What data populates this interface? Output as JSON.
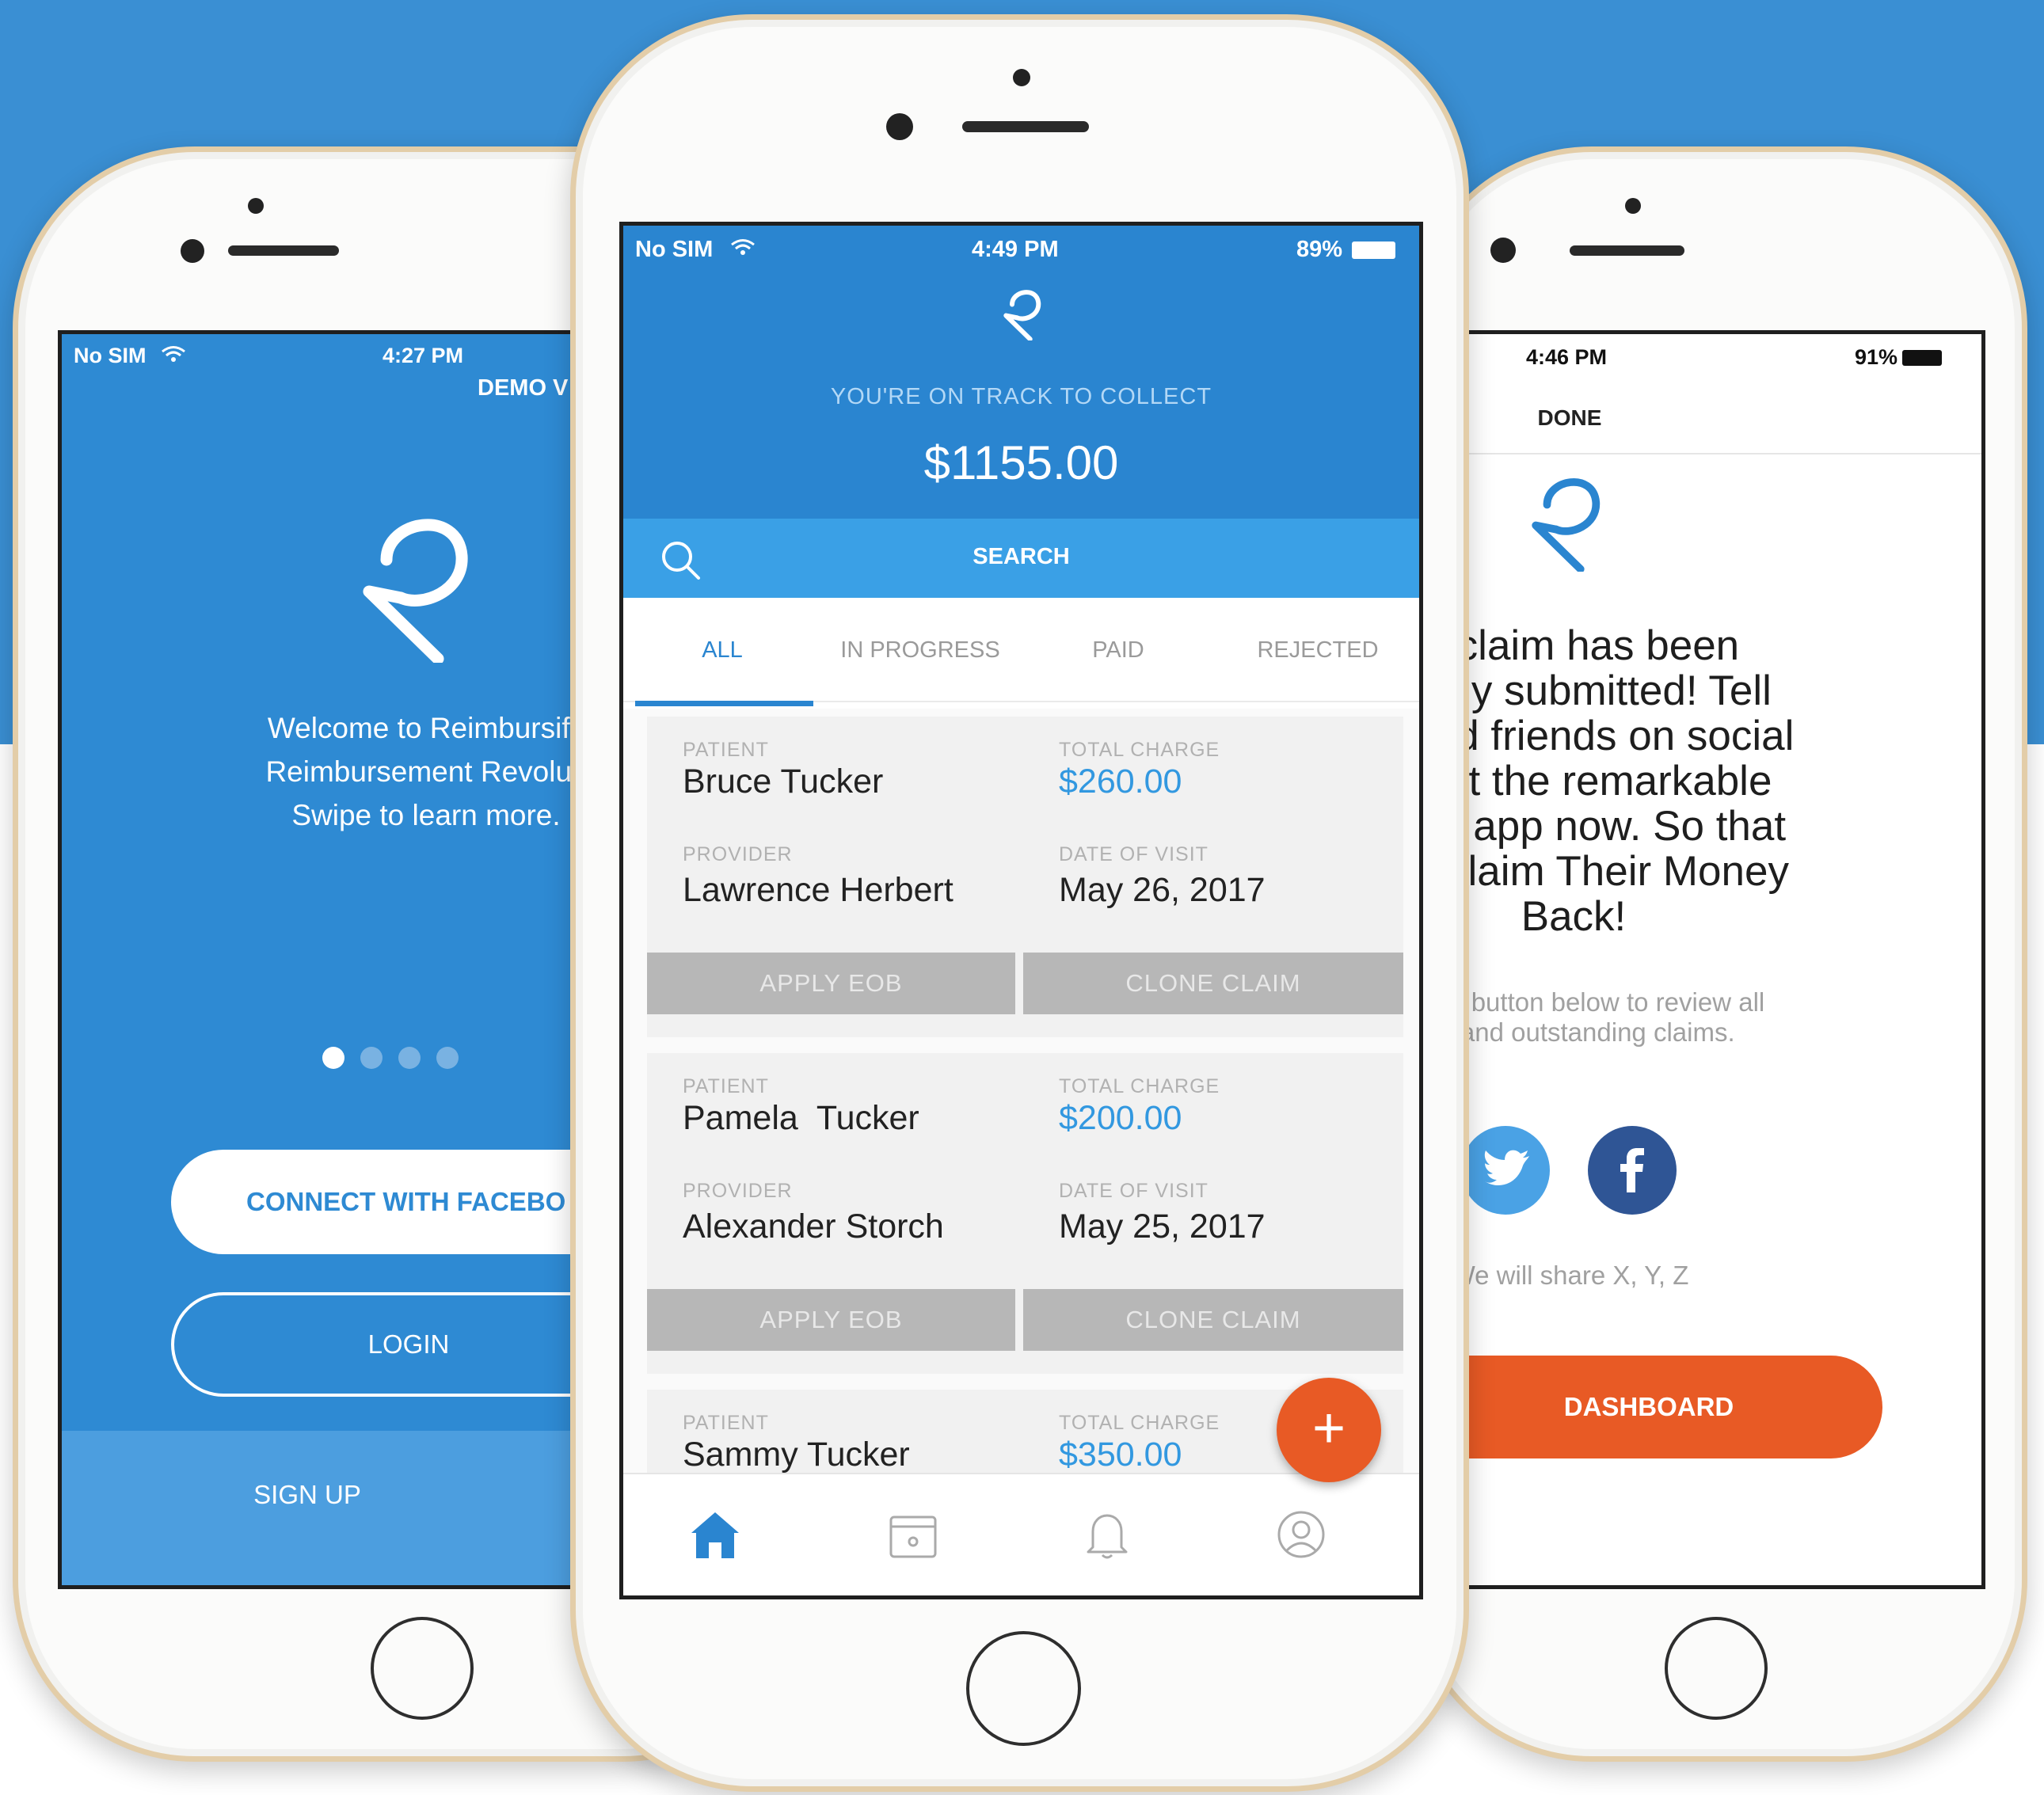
{
  "colors": {
    "brand_blue": "#2a85d0",
    "search_blue": "#3aa0e6",
    "money_blue": "#3298e0",
    "accent_orange": "#e85a25",
    "facebook_blue": "#2f5595",
    "twitter_blue": "#4aa2e5",
    "phone_frame_gold": "#e3cda8"
  },
  "left_screen": {
    "status": {
      "carrier": "No SIM",
      "time": "4:27 PM"
    },
    "demo_label": "DEMO V",
    "welcome_lines": [
      "Welcome to Reimbursify",
      "Reimbursement Revoluti",
      "Swipe to learn more."
    ],
    "pager": {
      "count": 4,
      "active_index": 0
    },
    "connect_facebook_label": "CONNECT WITH FACEBO",
    "login_label": "LOGIN",
    "signup_label": "SIGN UP"
  },
  "center_screen": {
    "status": {
      "carrier": "No SIM",
      "time": "4:49 PM",
      "battery": "89%"
    },
    "track_label": "YOU'RE ON TRACK TO COLLECT",
    "amount": "$1155.00",
    "search_label": "SEARCH",
    "tabs": [
      {
        "label": "ALL",
        "active": true
      },
      {
        "label": "IN PROGRESS",
        "active": false
      },
      {
        "label": "PAID",
        "active": false
      },
      {
        "label": "REJECTED",
        "active": false
      }
    ],
    "field_labels": {
      "patient": "PATIENT",
      "total_charge": "TOTAL CHARGE",
      "provider": "PROVIDER",
      "date_of_visit": "DATE OF VISIT"
    },
    "claims": [
      {
        "patient": "Bruce Tucker",
        "total_charge": "$260.00",
        "provider": "Lawrence Herbert",
        "date_of_visit": "May 26, 2017",
        "apply_eob_label": "APPLY EOB",
        "clone_claim_label": "CLONE CLAIM"
      },
      {
        "patient": "Pamela  Tucker",
        "total_charge": "$200.00",
        "provider": "Alexander Storch",
        "date_of_visit": "May 25, 2017",
        "apply_eob_label": "APPLY EOB",
        "clone_claim_label": "CLONE CLAIM"
      },
      {
        "patient": "Sammy Tucker",
        "total_charge": "$350.00"
      }
    ],
    "fab_label": "+",
    "bottom_nav": [
      {
        "icon": "home-icon",
        "active": true
      },
      {
        "icon": "calendar-icon",
        "active": false
      },
      {
        "icon": "bell-icon",
        "active": false
      },
      {
        "icon": "profile-icon",
        "active": false
      }
    ]
  },
  "right_screen": {
    "status": {
      "time": "4:46 PM",
      "battery": "91%"
    },
    "done_label": "DONE",
    "message_lines": [
      "ur claim has been",
      "ssfully submitted! Tell",
      "ns and friends on social",
      "about the remarkable",
      "ursify app now. So that",
      "can Claim Their Money",
      "Back!"
    ],
    "sub_lines": [
      "orange button below to review all",
      "iled and outstanding claims."
    ],
    "share_text": "We will share X, Y, Z",
    "dashboard_label": "DASHBOARD"
  }
}
